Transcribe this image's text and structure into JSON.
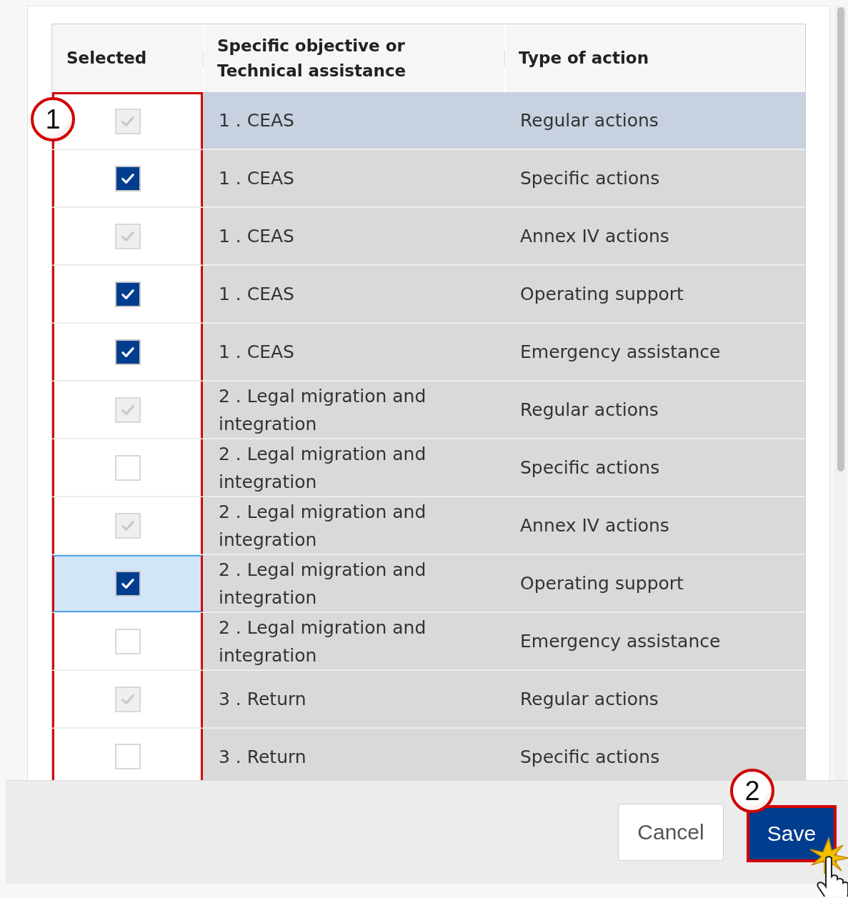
{
  "table": {
    "columns": [
      "Selected",
      "Specific objective or Technical assistance",
      "Type of action"
    ],
    "rows": [
      {
        "checked": true,
        "disabled": true,
        "hovered": true,
        "selected": false,
        "objective": "1 . CEAS",
        "action": "Regular actions"
      },
      {
        "checked": true,
        "disabled": false,
        "hovered": false,
        "selected": false,
        "objective": "1 . CEAS",
        "action": "Specific actions"
      },
      {
        "checked": true,
        "disabled": true,
        "hovered": false,
        "selected": false,
        "objective": "1 . CEAS",
        "action": "Annex IV actions"
      },
      {
        "checked": true,
        "disabled": false,
        "hovered": false,
        "selected": false,
        "objective": "1 . CEAS",
        "action": "Operating support"
      },
      {
        "checked": true,
        "disabled": false,
        "hovered": false,
        "selected": false,
        "objective": "1 . CEAS",
        "action": "Emergency assistance"
      },
      {
        "checked": true,
        "disabled": true,
        "hovered": false,
        "selected": false,
        "objective": "2 . Legal migration and integration",
        "action": "Regular actions"
      },
      {
        "checked": false,
        "disabled": false,
        "hovered": false,
        "selected": false,
        "objective": "2 . Legal migration and integration",
        "action": "Specific actions"
      },
      {
        "checked": true,
        "disabled": true,
        "hovered": false,
        "selected": false,
        "objective": "2 . Legal migration and integration",
        "action": "Annex IV actions"
      },
      {
        "checked": true,
        "disabled": false,
        "hovered": false,
        "selected": true,
        "objective": "2 . Legal migration and integration",
        "action": "Operating support"
      },
      {
        "checked": false,
        "disabled": false,
        "hovered": false,
        "selected": false,
        "objective": "2 . Legal migration and integration",
        "action": "Emergency assistance"
      },
      {
        "checked": true,
        "disabled": true,
        "hovered": false,
        "selected": false,
        "objective": "3 . Return",
        "action": "Regular actions"
      },
      {
        "checked": false,
        "disabled": false,
        "hovered": false,
        "selected": false,
        "objective": "3 . Return",
        "action": "Specific actions"
      }
    ]
  },
  "buttons": [
    {
      "label": "Cancel",
      "kind": "secondary"
    },
    {
      "label": "Save",
      "kind": "primary"
    }
  ],
  "callouts": [
    {
      "label": "1"
    },
    {
      "label": "2"
    }
  ]
}
